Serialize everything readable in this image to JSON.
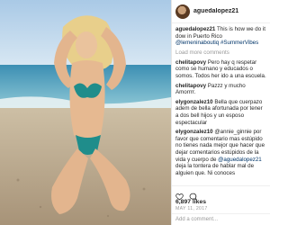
{
  "post": {
    "username": "aguedalopez21",
    "caption_user": "aguedalopez21",
    "caption_text": "This is how we do it dow in Puerto Rico",
    "caption_mention": "@lemeninaboutiq",
    "caption_tag": "#SummerVibes",
    "load_more": "Load more comments",
    "comments": [
      {
        "user": "chelitapovy",
        "text": "Pero hay q respetar como se humano y educados o somos. Todos her ido a una escuela."
      },
      {
        "user": "chelitapovy",
        "text": "Pazzz y mucho Amorrrr."
      },
      {
        "user": "elygonzalez10",
        "text": "Bella que cuerpazo adem de bella afortunada por tener a dos bell hijos y un esposo espectacular"
      },
      {
        "user": "elygonzalez10",
        "text": "@annie_ginnie por favor que comentario mas estúpido no tienes nada mejor que hacer que dejar comentarios estúpidos de la vida y cuerpo de",
        "mention": "@aguedalopez21",
        "tail": "deja la tontera de hablar mal de alguien que. Ni conoces"
      }
    ],
    "likes": "6,897 likes",
    "date": "MAY 11, 2017",
    "add_comment": "Add a comment..."
  },
  "colors": {
    "accent": "#003569",
    "border": "#efefef",
    "muted": "#999999"
  }
}
